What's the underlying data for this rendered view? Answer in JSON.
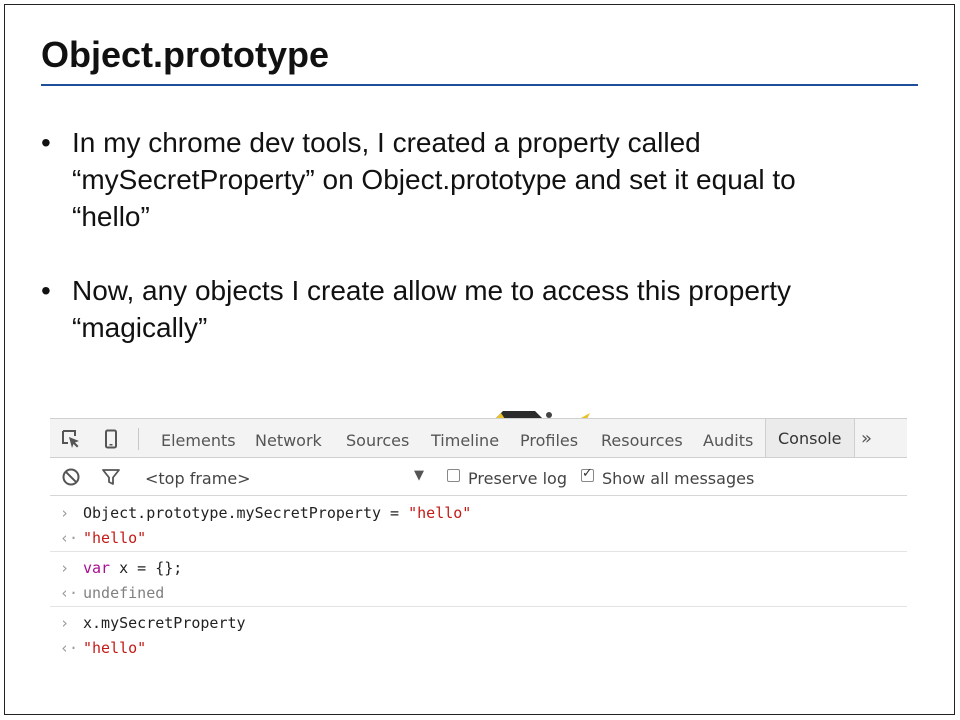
{
  "slide": {
    "title": "Object.prototype",
    "bullets": [
      {
        "marker": "•",
        "lines": [
          "In my chrome dev tools, I created a property called",
          "“mySecretProperty” on Object.prototype and set it equal to",
          "“hello”"
        ]
      },
      {
        "marker": "•",
        "lines": [
          "Now, any objects I create allow me to access this property",
          "“magically”"
        ]
      }
    ]
  },
  "devtools": {
    "tabs": [
      "Elements",
      "Network",
      "Sources",
      "Timeline",
      "Profiles",
      "Resources",
      "Audits",
      "Console"
    ],
    "active_tab": "Console",
    "more_label": "»",
    "frame_select": "<top frame>",
    "frame_arrow": "▼",
    "preserve_log": {
      "label": "Preserve log",
      "checked": false
    },
    "show_all": {
      "label": "Show all messages",
      "checked": true
    },
    "prompt_glyph": "›",
    "result_glyph": "‹·",
    "entries": [
      {
        "input_prefix": "Object.prototype.mySecretProperty = ",
        "input_string": "\"hello\"",
        "output": "\"hello\"",
        "output_kind": "string"
      },
      {
        "input_keyword": "var",
        "input_rest": " x = {};",
        "output": "undefined",
        "output_kind": "undefined"
      },
      {
        "input_plain": "x.mySecretProperty",
        "output": "\"hello\"",
        "output_kind": "string"
      }
    ],
    "colors": {
      "string": "#c41a16",
      "keyword": "#aa0d91",
      "undefined": "#808080",
      "title_rule": "#1f4e9a"
    }
  }
}
